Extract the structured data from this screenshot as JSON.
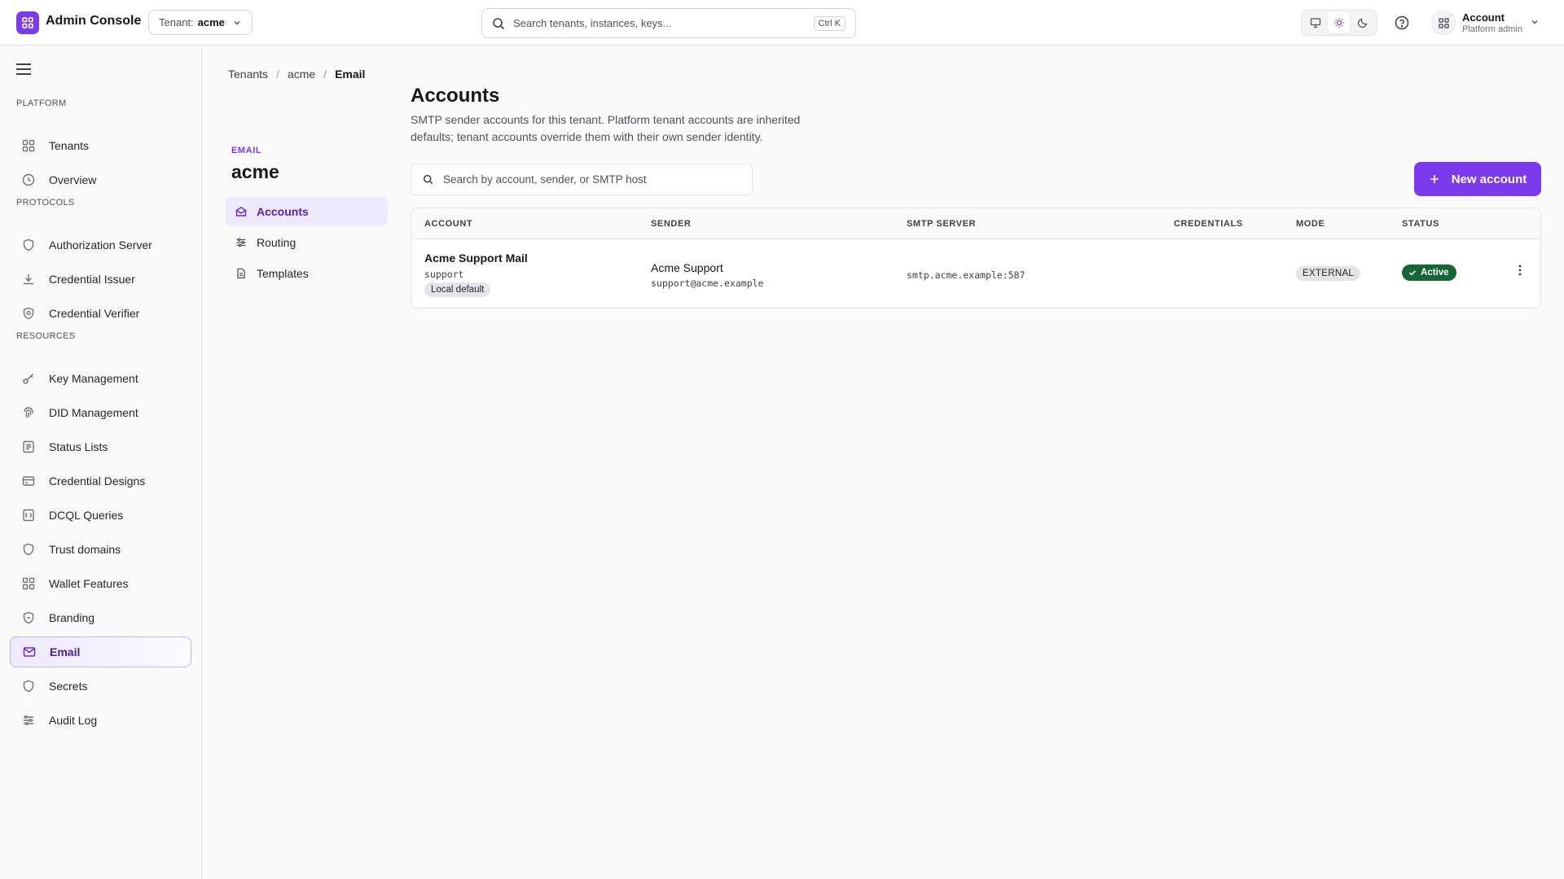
{
  "app": {
    "title": "Admin Console"
  },
  "tenant": {
    "label": "Tenant:",
    "value": "acme"
  },
  "search": {
    "placeholder": "Search tenants, instances, keys...",
    "shortcut": "Ctrl K"
  },
  "account": {
    "name": "Account",
    "role": "Platform admin"
  },
  "theme": {
    "modes": [
      "system-monitor-icon",
      "sun-icon",
      "moon-icon"
    ],
    "active": "light"
  },
  "sidebar": {
    "sections": [
      {
        "label": "PLATFORM",
        "items": [
          {
            "label": "Tenants",
            "icon": "grid-icon"
          },
          {
            "label": "Overview",
            "icon": "clock-icon"
          }
        ]
      },
      {
        "label": "PROTOCOLS",
        "items": [
          {
            "label": "Authorization Server",
            "icon": "shield-icon"
          },
          {
            "label": "Credential Issuer",
            "icon": "download-icon"
          },
          {
            "label": "Credential Verifier",
            "icon": "shield-check-icon"
          }
        ]
      },
      {
        "label": "RESOURCES",
        "items": [
          {
            "label": "Key Management",
            "icon": "key-icon"
          },
          {
            "label": "DID Management",
            "icon": "fingerprint-icon"
          },
          {
            "label": "Status Lists",
            "icon": "list-icon"
          },
          {
            "label": "Credential Designs",
            "icon": "card-icon"
          },
          {
            "label": "DCQL Queries",
            "icon": "query-icon"
          },
          {
            "label": "Trust domains",
            "icon": "shield-icon"
          },
          {
            "label": "Wallet Features",
            "icon": "grid-icon"
          },
          {
            "label": "Branding",
            "icon": "badge-icon"
          },
          {
            "label": "Email",
            "icon": "mail-icon",
            "active": true
          },
          {
            "label": "Secrets",
            "icon": "shield-icon"
          },
          {
            "label": "Audit Log",
            "icon": "sliders-icon"
          }
        ]
      }
    ]
  },
  "breadcrumb": [
    "Tenants",
    "acme",
    "Email"
  ],
  "subnav": {
    "eyebrow": "EMAIL",
    "title": "acme",
    "items": [
      {
        "label": "Accounts",
        "icon": "mail-open-icon",
        "active": true
      },
      {
        "label": "Routing",
        "icon": "sliders-icon"
      },
      {
        "label": "Templates",
        "icon": "file-icon"
      }
    ]
  },
  "main": {
    "title": "Accounts",
    "description": "SMTP sender accounts for this tenant. Platform tenant accounts are inherited defaults; tenant accounts override them with their own sender identity.",
    "search_placeholder": "Search by account, sender, or SMTP host",
    "new_button": "New account",
    "accent_color": "#7c3aed"
  },
  "table": {
    "columns": [
      "ACCOUNT",
      "SENDER",
      "SMTP SERVER",
      "CREDENTIALS",
      "MODE",
      "STATUS"
    ],
    "rows": [
      {
        "account_name": "Acme Support Mail",
        "account_key": "support",
        "account_tag": "Local default",
        "sender_name": "Acme Support",
        "sender_email": "support@acme.example",
        "smtp_server": "smtp.acme.example:587",
        "credentials": "",
        "mode": "EXTERNAL",
        "status": "Active",
        "status_color": "#166534"
      }
    ]
  }
}
